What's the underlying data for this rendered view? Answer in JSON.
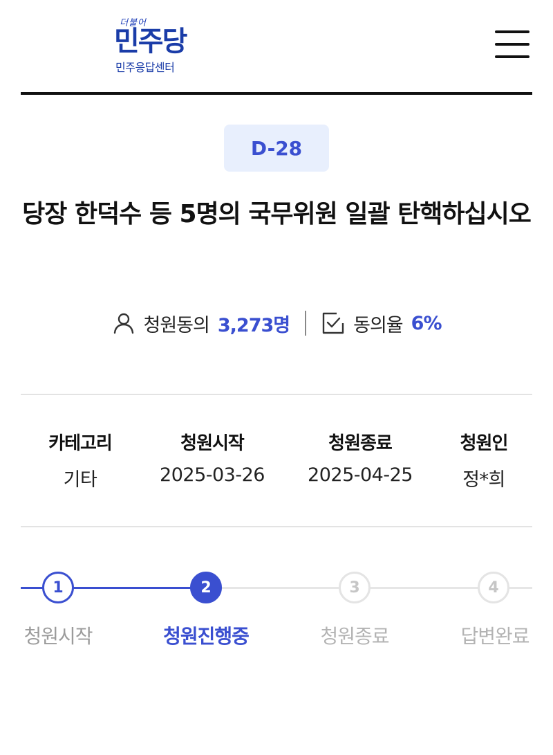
{
  "header": {
    "logo_top": "더불어",
    "logo_main": "민주당",
    "logo_sub": "민주응답센터"
  },
  "petition": {
    "dday": "D-28",
    "title": "당장 한덕수 등 5명의 국무위원 일괄 탄핵하십시오",
    "stats": {
      "agree_label": "청원동의",
      "agree_value": "3,273명",
      "rate_label": "동의율",
      "rate_value": "6%"
    },
    "info": [
      {
        "label": "카테고리",
        "value": "기타"
      },
      {
        "label": "청원시작",
        "value": "2025-03-26"
      },
      {
        "label": "청원종료",
        "value": "2025-04-25"
      },
      {
        "label": "청원인",
        "value": "정*희"
      }
    ],
    "steps": [
      {
        "number": "1",
        "label": "청원시작",
        "state": "done"
      },
      {
        "number": "2",
        "label": "청원진행중",
        "state": "active"
      },
      {
        "number": "3",
        "label": "청원종료",
        "state": "todo"
      },
      {
        "number": "4",
        "label": "답변완료",
        "state": "todo"
      }
    ]
  },
  "colors": {
    "accent": "#3a4fd0",
    "brand": "#1a3ca8",
    "badge_bg": "#e8effd"
  }
}
